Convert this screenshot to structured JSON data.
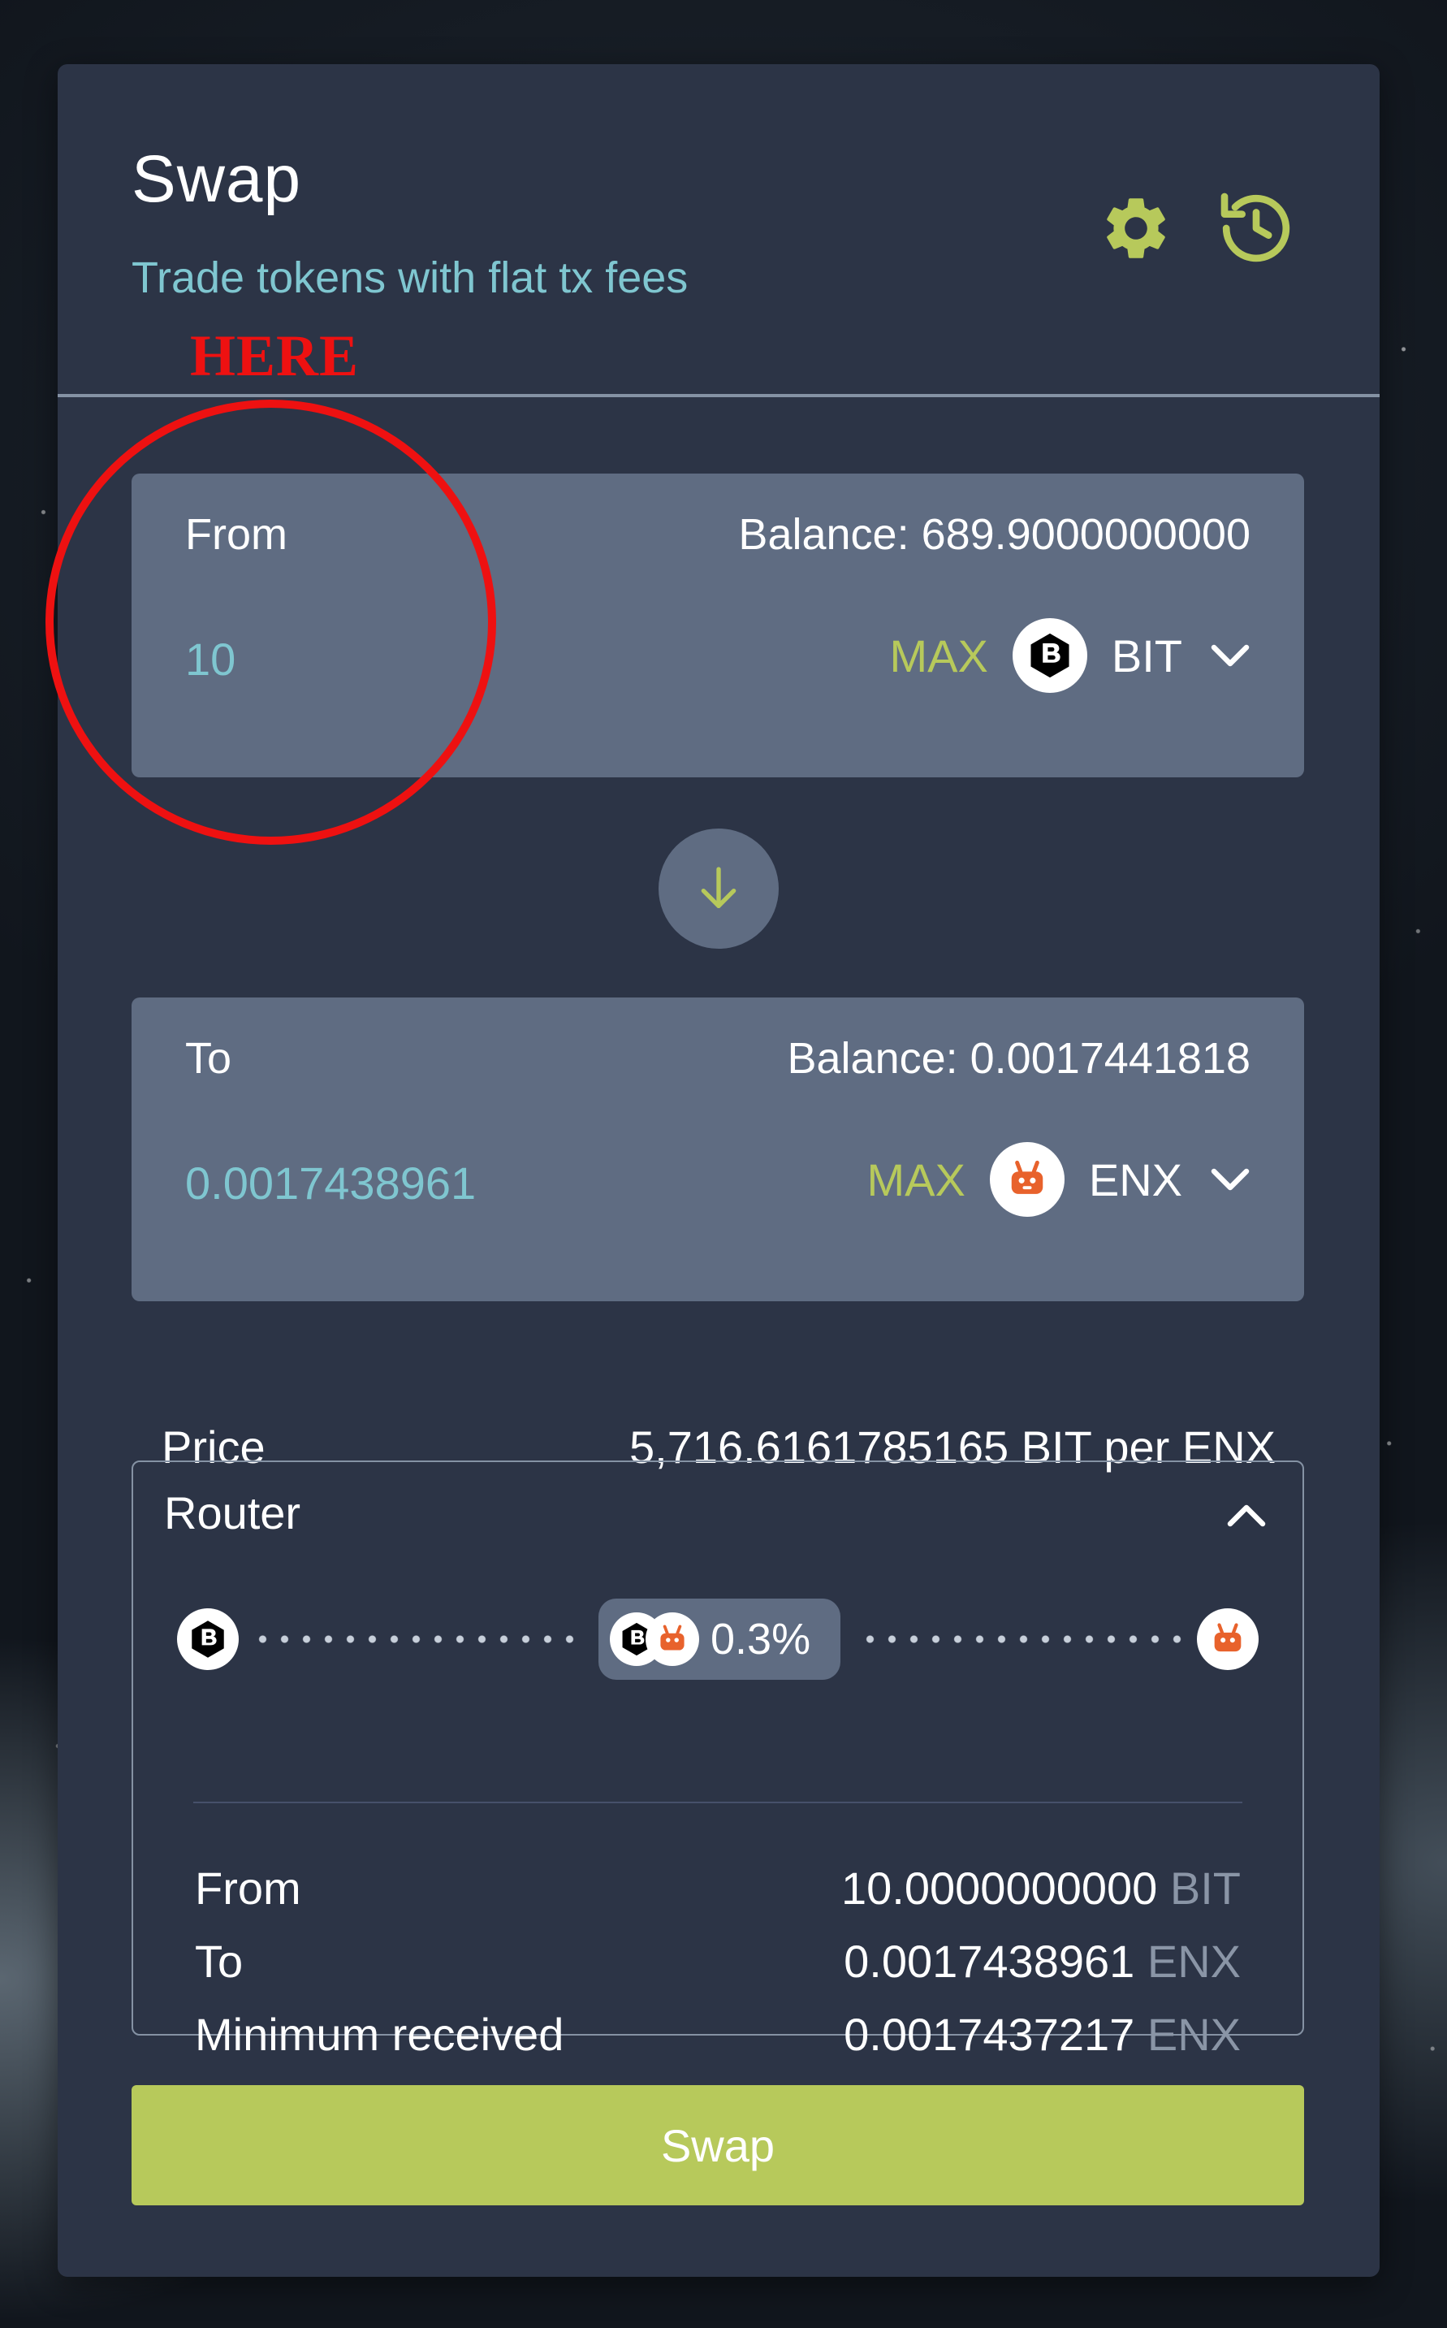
{
  "swap": {
    "title": "Swap",
    "subtitle": "Trade tokens with flat tx fees",
    "settings_icon": "gear-icon",
    "history_icon": "history-icon",
    "accent_color": "#b7c95b",
    "value_color": "#7fc6d0"
  },
  "from": {
    "label": "From",
    "balance": "Balance: 689.9000000000",
    "amount": "10",
    "max_label": "MAX",
    "token": "BIT"
  },
  "to": {
    "label": "To",
    "balance": "Balance: 0.0017441818",
    "amount": "0.0017438961",
    "max_label": "MAX",
    "token": "ENX"
  },
  "price": {
    "label": "Price",
    "value": "5,716.6161785165 BIT per ENX"
  },
  "router": {
    "title": "Router",
    "fee": "0.3%",
    "details": [
      {
        "label": "From",
        "value": "10.0000000000",
        "unit": "BIT"
      },
      {
        "label": "To",
        "value": "0.0017438961",
        "unit": "ENX"
      },
      {
        "label": "Minimum received",
        "value": "0.0017437217",
        "unit": "ENX"
      }
    ]
  },
  "swap_button": {
    "label": "Swap"
  },
  "annotation": {
    "text": "HERE",
    "color": "#ee1111"
  }
}
